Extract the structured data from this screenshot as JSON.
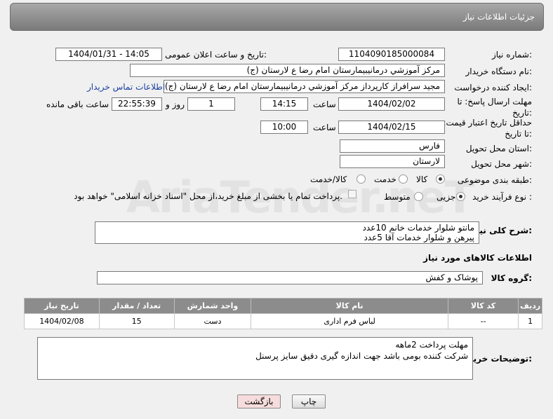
{
  "header": {
    "title": "جزئیات اطلاعات نیاز"
  },
  "labels": {
    "need_number": "شماره نیاز:",
    "announce_datetime": "تاریخ و ساعت اعلان عمومی:",
    "buyer_org": "نام دستگاه خریدار:",
    "requester": "ایجاد کننده درخواست:",
    "reply_deadline": "مهلت ارسال پاسخ: تا تاریخ:",
    "price_validity": "حداقل تاریخ اعتبار قیمت: تا تاریخ:",
    "time": "ساعت",
    "day_and": "روز و",
    "remaining": "ساعت باقی مانده",
    "province": "استان محل تحویل:",
    "city": "شهر محل تحویل:",
    "category": "طبقه بندی موضوعی:",
    "process_type": "نوع فرآیند خرید :",
    "description": "شرح کلی نیاز:",
    "goods_info": "اطلاعات کالاهای مورد نیاز",
    "goods_group": "گروه کالا:",
    "buyer_notes": "توضیحات خریدار:"
  },
  "values": {
    "need_number": "1104090185000084",
    "announce_datetime": "1404/01/31 - 14:05",
    "buyer_org": "مرکز آموزشي درمانيبيمارستان امام رضا  ع  لارستان (ج)",
    "requester": "مجید سرافراز کارپرداز  مرکز آموزشي درمانيبيمارستان امام رضا  ع  لارستان (ج)",
    "contact_link": "اطلاعات تماس خریدار",
    "reply_date": "1404/02/02",
    "reply_time": "14:15",
    "reply_days": "1",
    "reply_remaining": "22:55:39",
    "validity_date": "1404/02/15",
    "validity_time": "10:00",
    "province": "فارس",
    "city": "لارستان",
    "description_line1": "مانتو شلوار خدمات خانم         10عدد",
    "description_line2": "پیرهن و شلوار خدمات آقا          5عدد",
    "goods_group": "پوشاک و کفش",
    "buyer_notes_line1": "مهلت پرداخت 2ماهه",
    "buyer_notes_line2": "شرکت کننده بومی باشد جهت اندازه گیری دقیق سایز پرسنل"
  },
  "category_options": {
    "goods": "کالا",
    "service": "خدمت",
    "goods_service": "کالا/خدمت",
    "selected": "کالا"
  },
  "process_options": {
    "partial": "جزیی",
    "medium": "متوسط",
    "selected": "جزیی"
  },
  "payment_note": "پرداخت تمام یا بخشی از مبلغ خرید،از محل \"اسناد خزانه اسلامی\" خواهد بود.",
  "table": {
    "headers": [
      "ردیف",
      "کد کالا",
      "نام کالا",
      "واحد شمارش",
      "تعداد / مقدار",
      "تاریخ نیاز"
    ],
    "rows": [
      [
        "1",
        "--",
        "لباس فرم اداری",
        "دست",
        "15",
        "1404/02/08"
      ]
    ]
  },
  "buttons": {
    "print": "چاپ",
    "back": "بازگشت"
  },
  "watermark": "AriaTender.neT"
}
